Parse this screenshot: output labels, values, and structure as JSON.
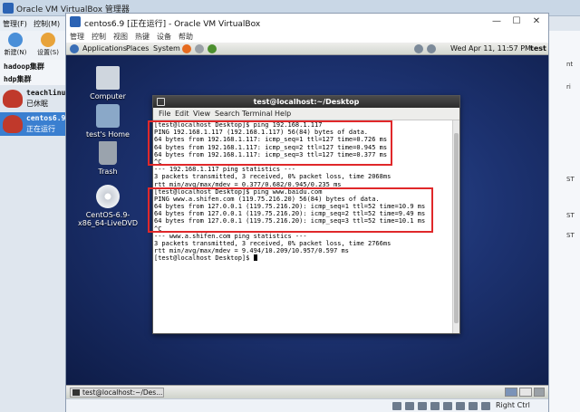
{
  "manager": {
    "title": "Oracle VM VirtualBox 管理器",
    "menu": [
      "管理(F)",
      "控制(M)"
    ],
    "toolbar": {
      "new_label": "新建(N)",
      "settings_label": "设置(S)"
    },
    "groups": [
      {
        "name": "hadoop集群"
      },
      {
        "name": "hdp集群"
      }
    ],
    "vms": [
      {
        "name": "teachlinu",
        "status": "已休眠",
        "badge": "64"
      },
      {
        "name": "centos6.9",
        "status": "正在运行",
        "badge": "64"
      }
    ],
    "right_strip": [
      "nt",
      "ri",
      "ST",
      "ST",
      "ST"
    ]
  },
  "vm_window": {
    "title": "centos6.9 [正在运行] - Oracle VM VirtualBox",
    "menu": [
      "管理",
      "控制",
      "视图",
      "热键",
      "设备",
      "帮助"
    ],
    "controls": {
      "minimize": "—",
      "maximize": "☐",
      "close": "✕"
    }
  },
  "gnome": {
    "panel_menus": [
      "Applications",
      "Places",
      "System"
    ],
    "clock": "Wed Apr 11, 11:57 PM",
    "user": "test"
  },
  "desktop_icons": [
    {
      "label": "Computer"
    },
    {
      "label": "test's Home"
    },
    {
      "label": "Trash"
    },
    {
      "label": "CentOS-6.9-x86_64-LiveDVD"
    }
  ],
  "terminal": {
    "title": "test@localhost:~/Desktop",
    "menu": [
      "File",
      "Edit",
      "View",
      "Search",
      "Terminal",
      "Help"
    ],
    "lines": [
      "[test@localhost Desktop]$ ping 192.168.1.117",
      "PING 192.168.1.117 (192.168.1.117) 56(84) bytes of data.",
      "64 bytes from 192.168.1.117: icmp_seq=1 ttl=127 time=0.726 ms",
      "64 bytes from 192.168.1.117: icmp_seq=2 ttl=127 time=0.945 ms",
      "64 bytes from 192.168.1.117: icmp_seq=3 ttl=127 time=0.377 ms",
      "^C",
      "--- 192.168.1.117 ping statistics ---",
      "3 packets transmitted, 3 received, 0% packet loss, time 2068ms",
      "rtt min/avg/max/mdev = 0.377/0.682/0.945/0.235 ms",
      "[test@localhost Desktop]$ ping www.baidu.com",
      "PING www.a.shifen.com (119.75.216.20) 56(84) bytes of data.",
      "64 bytes from 127.0.0.1 (119.75.216.20): icmp_seq=1 ttl=52 time=10.9 ms",
      "64 bytes from 127.0.0.1 (119.75.216.20): icmp_seq=2 ttl=52 time=9.49 ms",
      "64 bytes from 127.0.0.1 (119.75.216.20): icmp_seq=3 ttl=52 time=10.1 ms",
      "^C",
      "--- www.a.shifen.com ping statistics ---",
      "3 packets transmitted, 3 received, 0% packet loss, time 2766ms",
      "rtt min/avg/max/mdev = 9.494/10.209/10.957/0.597 ms",
      "[test@localhost Desktop]$ "
    ],
    "highlight_color": "#e0282a"
  },
  "taskbar": {
    "task_label": "test@localhost:~/Des..."
  },
  "status_bar": {
    "host_key": "Right Ctrl"
  },
  "colors": {
    "desktop": "#1d3372",
    "selection": "#3a7fd0",
    "vm_icon": "#c0392b"
  }
}
